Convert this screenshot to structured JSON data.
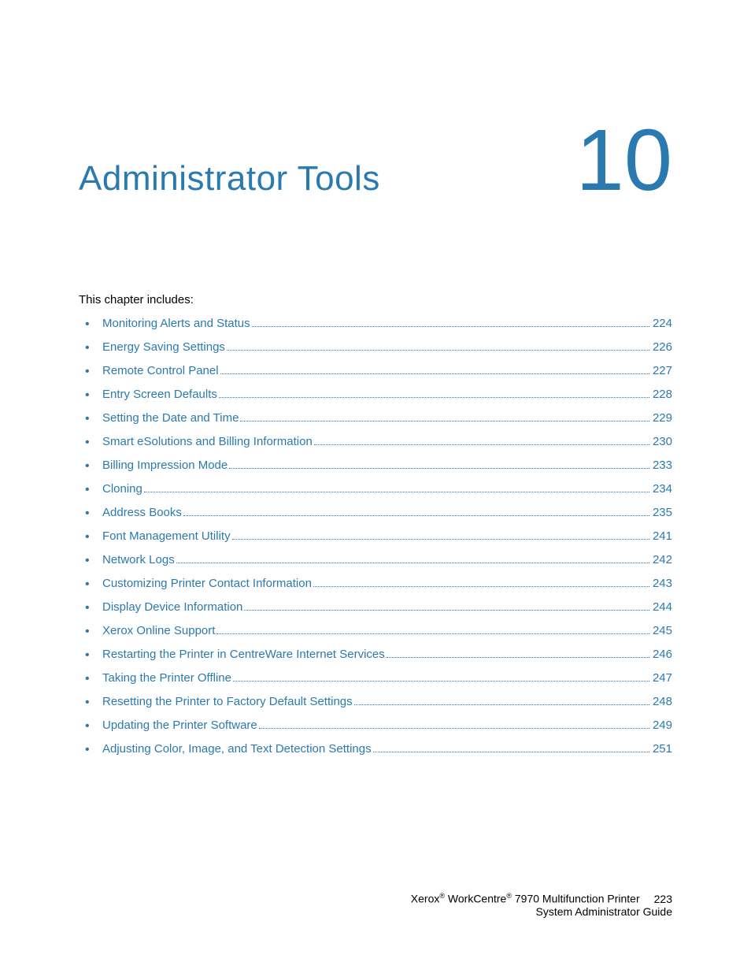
{
  "chapter": {
    "title": "Administrator Tools",
    "number": "10"
  },
  "intro": "This chapter includes:",
  "toc": [
    {
      "label": "Monitoring Alerts and Status",
      "page": "224"
    },
    {
      "label": "Energy Saving Settings",
      "page": "226"
    },
    {
      "label": "Remote Control Panel",
      "page": "227"
    },
    {
      "label": "Entry Screen Defaults",
      "page": "228"
    },
    {
      "label": "Setting the Date and Time",
      "page": "229"
    },
    {
      "label": "Smart eSolutions and Billing Information",
      "page": "230"
    },
    {
      "label": "Billing Impression Mode",
      "page": "233"
    },
    {
      "label": "Cloning",
      "page": "234"
    },
    {
      "label": "Address Books",
      "page": "235"
    },
    {
      "label": "Font Management Utility",
      "page": "241"
    },
    {
      "label": "Network Logs",
      "page": "242"
    },
    {
      "label": "Customizing Printer Contact Information",
      "page": "243"
    },
    {
      "label": "Display Device Information",
      "page": "244"
    },
    {
      "label": "Xerox Online Support",
      "page": "245"
    },
    {
      "label": "Restarting the Printer in CentreWare Internet Services",
      "page": "246"
    },
    {
      "label": "Taking the Printer Offline",
      "page": "247"
    },
    {
      "label": "Resetting the Printer to Factory Default Settings",
      "page": "248"
    },
    {
      "label": "Updating the Printer Software",
      "page": "249"
    },
    {
      "label": "Adjusting Color, Image, and Text Detection Settings",
      "page": "251"
    }
  ],
  "footer": {
    "brand1": "Xerox",
    "brand2": "WorkCentre",
    "product_rest": "7970 Multifunction Printer",
    "page_number": "223",
    "subtitle": "System Administrator Guide"
  }
}
